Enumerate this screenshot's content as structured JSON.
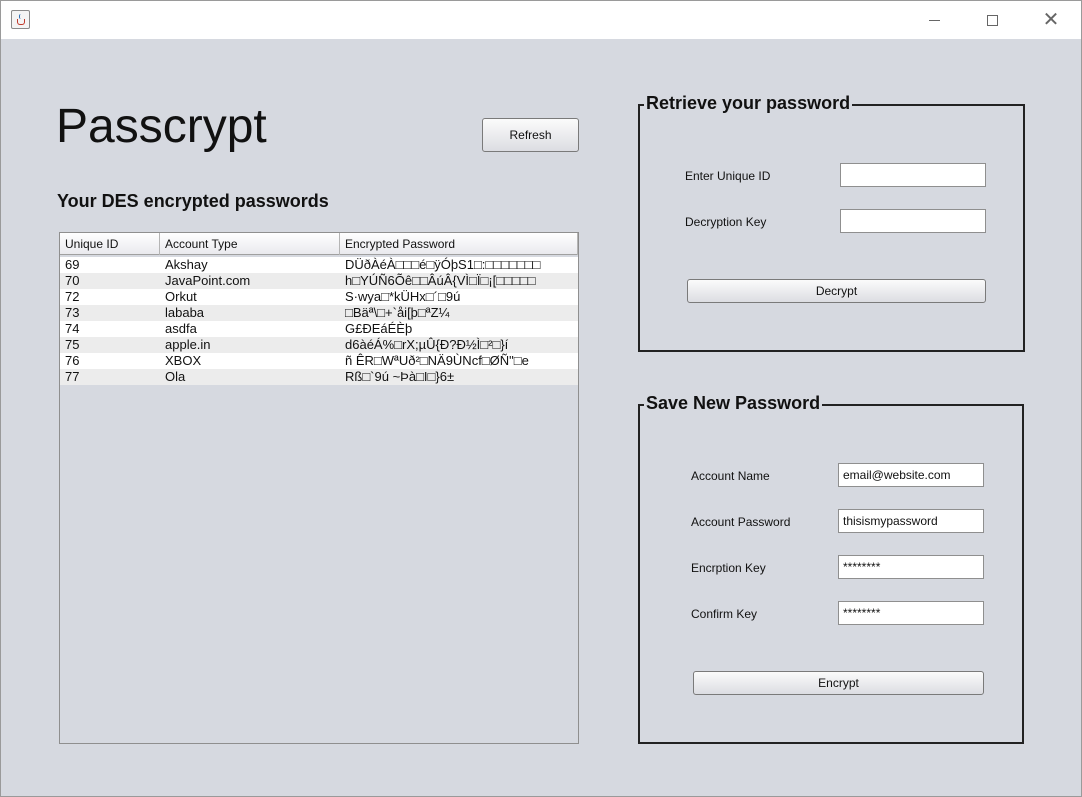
{
  "window": {
    "title": "",
    "controls": {
      "minimize_icon": "minimize-icon",
      "maximize_icon": "maximize-icon",
      "close_icon": "close-icon"
    }
  },
  "header": {
    "app_title": "Passcrypt",
    "refresh_label": "Refresh",
    "section_heading": "Your DES encrypted passwords"
  },
  "table": {
    "columns": [
      "Unique ID",
      "Account Type",
      "Encrypted Password"
    ],
    "rows": [
      [
        "69",
        "Akshay",
        "DÜðÀéÀ□□□é□ÿÓþS1□:□□□□□□□"
      ],
      [
        "70",
        "JavaPoint.com",
        "h□YÚÑ6Õê□□ÂúÂ{VÌ□Ï□¡[□□□□□"
      ],
      [
        "72",
        "Orkut",
        "S·wya□*kÜHx□´□9ú"
      ],
      [
        "73",
        "lababa",
        "□Bäª\\□+`åi[þ□ªZ¼"
      ],
      [
        "74",
        "asdfa",
        "G£ÐEáÉÈþ"
      ],
      [
        "75",
        "apple.in",
        "d6àéÁ%□rX;µÛ{Ð?Ð½Ì□²□}í"
      ],
      [
        "76",
        "XBOX",
        "ñ ÊR□WªUð²□NÄ9ÙNcf□ØÑ\"□e"
      ],
      [
        "77",
        "Ola",
        "Rß□`9ú ~Þà□I□}6±"
      ]
    ]
  },
  "retrieve": {
    "title": "Retrieve your password",
    "unique_id_label": "Enter Unique ID",
    "unique_id_value": "",
    "decryption_key_label": "Decryption Key",
    "decryption_key_value": "",
    "decrypt_label": "Decrypt"
  },
  "save": {
    "title": "Save New Password",
    "account_name_label": "Account Name",
    "account_name_value": "email@website.com",
    "account_password_label": "Account Password",
    "account_password_value": "thisismypassword",
    "encryption_key_label": "Encrption Key",
    "encryption_key_value": "********",
    "confirm_key_label": "Confirm Key",
    "confirm_key_value": "********",
    "encrypt_label": "Encrypt"
  }
}
